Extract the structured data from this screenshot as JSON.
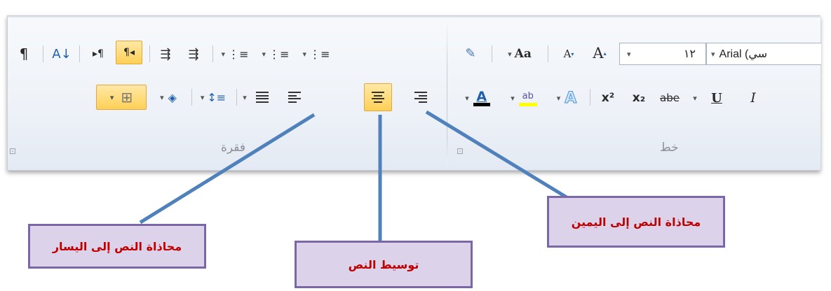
{
  "ribbon": {
    "groups": {
      "paragraph_label": "فقرة",
      "font_label": "خط"
    },
    "launcher_glyph": "⊡",
    "paragraph": {
      "show_marks": "¶",
      "sort": "A↓",
      "ltr_dir": "▸¶",
      "rtl_dir": "¶◂",
      "increase_indent": "⇶",
      "decrease_indent": "⇶",
      "multilevel_list": "⋮≡",
      "numbering": "⋮≡",
      "bullets": "⋮≡",
      "line_spacing": "↕≡",
      "shading": "◈",
      "borders": "⊞",
      "dropdown": "▾"
    },
    "font": {
      "change_case": "Aa",
      "shrink": "A",
      "grow": "A",
      "size": "١٢",
      "name": "Arial (سي",
      "font_color": "A",
      "highlight": "ab",
      "text_effects": "A",
      "superscript": "x²",
      "subscript": "x₂",
      "strikethrough": "abe",
      "underline": "U",
      "italic": "I",
      "dropdown": "▾"
    },
    "colors": {
      "font_color_bar": "#000000",
      "highlight_bar": "#ffff00",
      "active_fill": "#ffd056",
      "effects_blue": "#4a90d9"
    }
  },
  "callouts": {
    "align_left": "محاذاة النص إلى اليسار",
    "center": "توسيط النص",
    "align_right": "محاذاة النص إلى اليمين"
  },
  "callout_style": {
    "fill": "#dcd3ea",
    "border": "#7a67a6",
    "text": "#c00000",
    "line": "#4f81bd"
  }
}
